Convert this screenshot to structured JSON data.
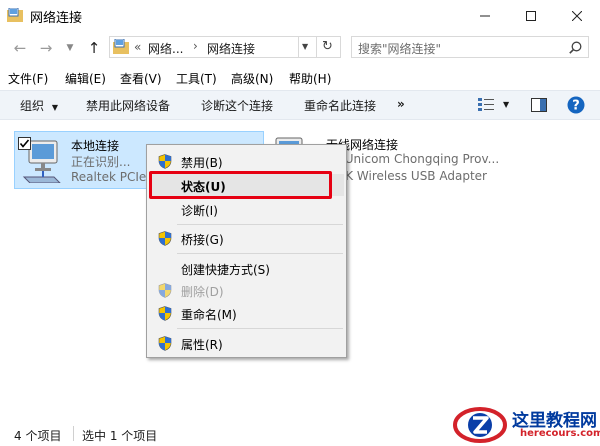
{
  "window": {
    "title": "网络连接"
  },
  "address": {
    "crumb_overflow": "«",
    "crumb_parent": "网络...",
    "crumb_current": "网络连接"
  },
  "search": {
    "placeholder": "搜索\"网络连接\""
  },
  "menubar": [
    "文件(F)",
    "编辑(E)",
    "查看(V)",
    "工具(T)",
    "高级(N)",
    "帮助(H)"
  ],
  "commandbar": {
    "organize": "组织",
    "disable_device": "禁用此网络设备",
    "diagnose": "诊断这个连接",
    "rename": "重命名此连接",
    "more": "»"
  },
  "connections": [
    {
      "name": "本地连接",
      "status": "正在识别...",
      "device": "Realtek PCIe"
    },
    {
      "name": "无线网络连接",
      "status": "na Unicom Chongqing Prov...",
      "device": "LINK Wireless USB Adapter"
    }
  ],
  "context_menu": {
    "items": [
      "禁用(B)",
      "状态(U)",
      "诊断(I)",
      "桥接(G)",
      "创建快捷方式(S)",
      "删除(D)",
      "重命名(M)",
      "属性(R)"
    ]
  },
  "statusbar": {
    "count": "4 个项目",
    "selected": "选中 1 个项目"
  },
  "watermark": {
    "title": "这里教程网",
    "url": "herecours.com"
  },
  "colors": {
    "highlight_box": "#e60012",
    "selection": "#cce8ff",
    "command_bar": "#f0f4f9"
  }
}
